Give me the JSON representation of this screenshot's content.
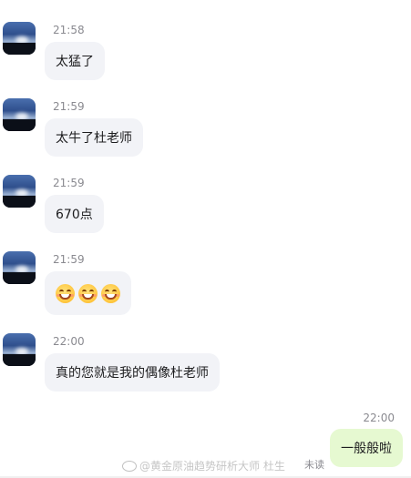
{
  "messages": [
    {
      "time": "21:58",
      "text": "太猛了"
    },
    {
      "time": "21:59",
      "text": "太牛了杜老师"
    },
    {
      "time": "21:59",
      "text": "670点"
    },
    {
      "time": "21:59",
      "emoji": [
        "grinning-face",
        "grinning-face",
        "grinning-face"
      ]
    },
    {
      "time": "22:00",
      "text": "真的您就是我的偶像杜老师"
    }
  ],
  "self_message": {
    "time": "22:00",
    "text": "一般般啦",
    "status": "未读"
  },
  "watermark": "@黄金原油趋势研析大师 杜生",
  "colors": {
    "incoming_bubble": "#f2f3f7",
    "outgoing_bubble": "#e6f9d1",
    "timestamp": "#8a8a90"
  }
}
